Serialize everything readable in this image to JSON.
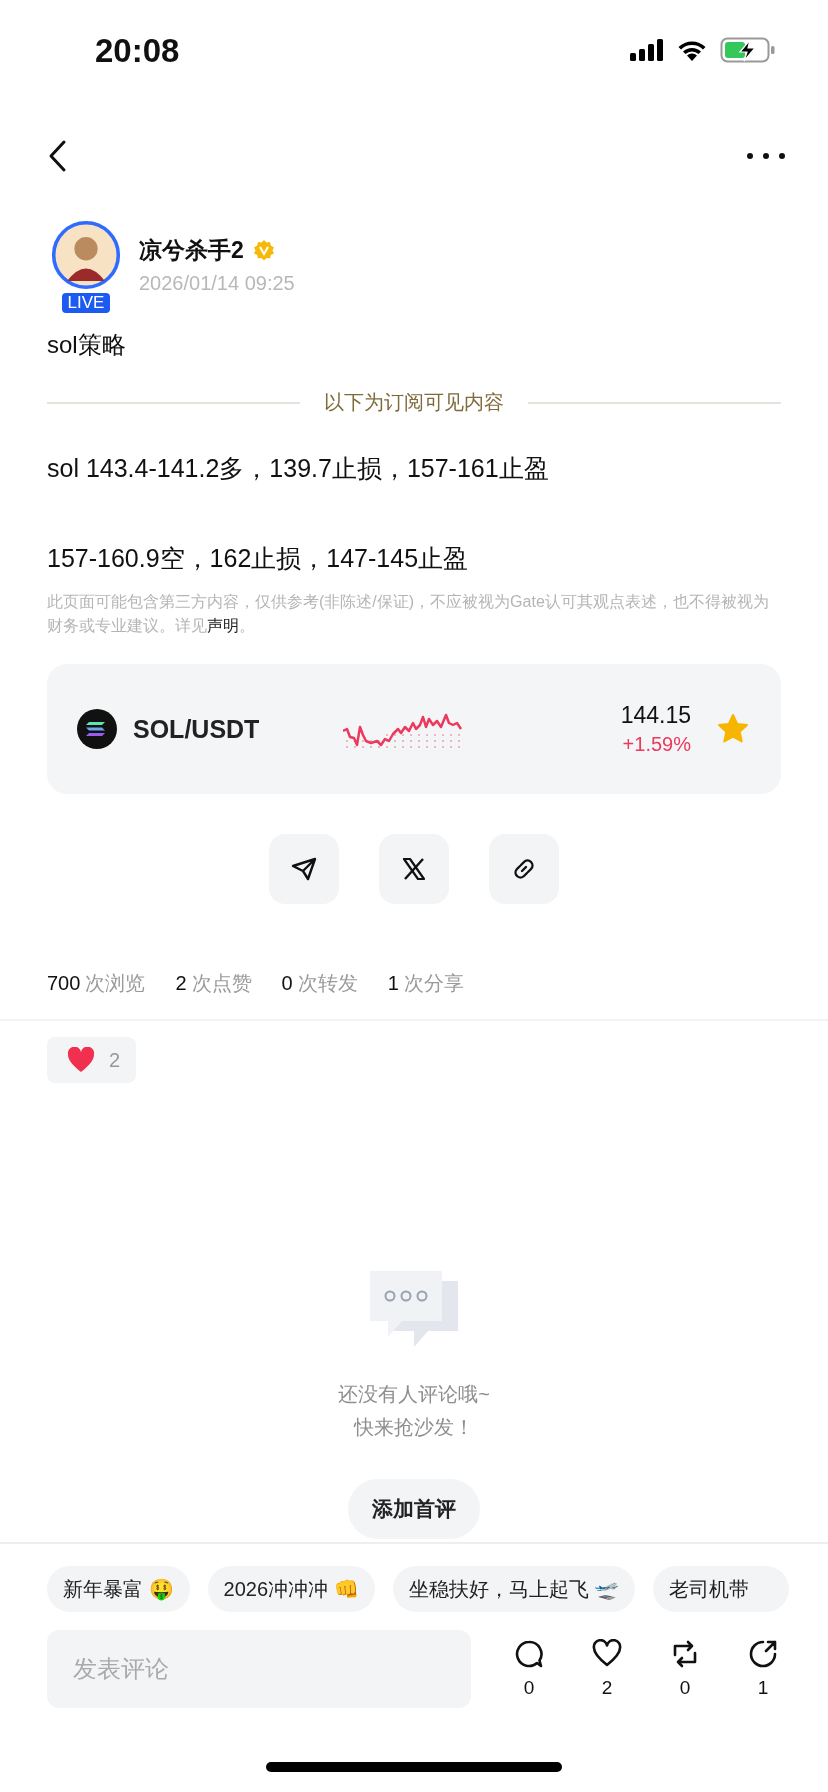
{
  "status_bar": {
    "time": "20:08"
  },
  "author": {
    "name": "凉兮杀手2",
    "verified": true,
    "live_badge": "LIVE",
    "time": "2026/01/14 09:25"
  },
  "title": "sol策略",
  "subscriber_divider": "以下为订阅可见内容",
  "body": [
    "sol 143.4-141.2多，139.7止损，157-161止盈",
    "157-160.9空，162止损，147-145止盈"
  ],
  "disclaimer": {
    "text": "此页面可能包含第三方内容，仅供参考(非陈述/保证)，不应被视为Gate认可其观点表述，也不得被视为财务或专业建议。详见",
    "link": "声明",
    "end": "。"
  },
  "ticker": {
    "pair": "SOL/USDT",
    "price": "144.15",
    "change": "+1.59%",
    "favorite": true
  },
  "share_buttons": [
    {
      "kind": "telegram"
    },
    {
      "kind": "x"
    },
    {
      "kind": "link"
    }
  ],
  "stats": [
    {
      "count": "700",
      "suffix": "次浏览"
    },
    {
      "count": "2",
      "suffix": "次点赞"
    },
    {
      "count": "0",
      "suffix": "次转发"
    },
    {
      "count": "1",
      "suffix": "次分享"
    }
  ],
  "reactions": [
    {
      "kind": "heart",
      "count": "2"
    }
  ],
  "empty_state": {
    "lines": [
      "还没有人评论哦~",
      "快来抢沙发！"
    ],
    "button": "添加首评"
  },
  "quick_replies": [
    "新年暴富 🤑",
    "2026冲冲冲 👊",
    "坐稳扶好，马上起飞 🛫",
    "老司机带"
  ],
  "comment_field": {
    "placeholder": "发表评论"
  },
  "actions": [
    {
      "kind": "comment",
      "count": "0"
    },
    {
      "kind": "like",
      "count": "2"
    },
    {
      "kind": "repost",
      "count": "0"
    },
    {
      "kind": "share",
      "count": "1"
    }
  ]
}
